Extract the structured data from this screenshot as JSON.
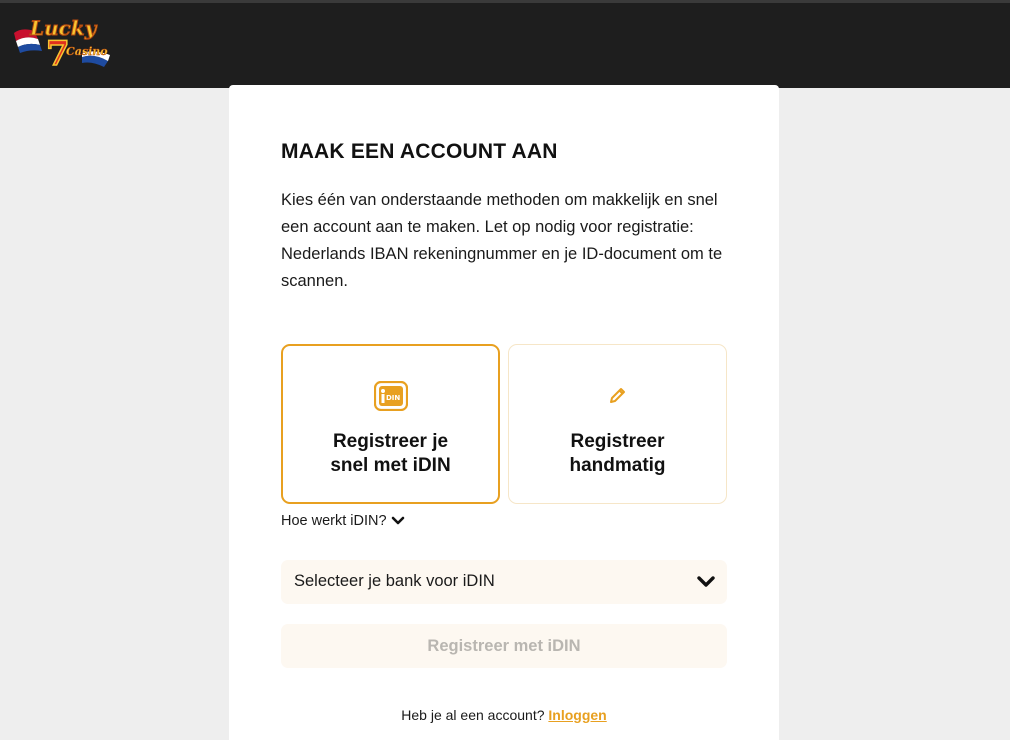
{
  "header": {
    "logo": {
      "text": "Lucky 7 Casino",
      "icon": "lucky7-casino-logo"
    }
  },
  "signup": {
    "title": "MAAK EEN ACCOUNT AAN",
    "intro": "Kies één van onderstaande methoden om makkelijk en snel een account aan te maken. Let op nodig voor registratie: Nederlands IBAN rekeningnummer en je ID-document om te scannen.",
    "methods": [
      {
        "label": "Registreer je\nsnel met iDIN",
        "icon": "idin-icon",
        "selected": true
      },
      {
        "label": "Registreer\nhandmatig",
        "icon": "pencil-icon",
        "selected": false
      }
    ],
    "how_link": "Hoe werkt iDIN?",
    "bank_select": {
      "value": "Selecteer je bank voor iDIN"
    },
    "submit_label": "Registreer met iDIN",
    "login_prompt": "Heb je al een account?",
    "login_link": "Inloggen"
  },
  "colors": {
    "accent": "#e8a020",
    "header_bg": "#1e1e1e",
    "page_bg": "#eeeeee",
    "field_bg": "#fdf8f1",
    "disabled_text": "#b9b6b1"
  }
}
